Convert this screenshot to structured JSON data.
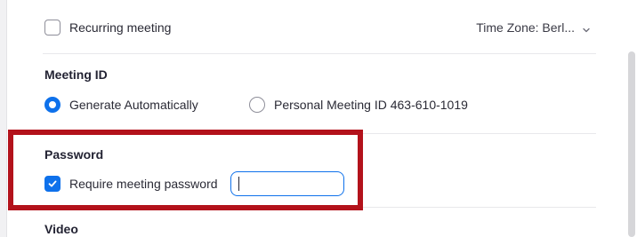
{
  "recurring": {
    "label": "Recurring meeting",
    "checked": false
  },
  "timezone": {
    "label": "Time Zone: Berl...",
    "icon": "chevron-down-icon"
  },
  "meeting_id": {
    "title": "Meeting ID",
    "options": [
      {
        "label": "Generate Automatically",
        "selected": true
      },
      {
        "label": "Personal Meeting ID 463-610-1019",
        "selected": false
      }
    ]
  },
  "password": {
    "title": "Password",
    "require_label": "Require meeting password",
    "require_checked": true,
    "input_value": ""
  },
  "video": {
    "title": "Video"
  },
  "colors": {
    "accent": "#0e71eb",
    "highlight": "#b3121b"
  }
}
